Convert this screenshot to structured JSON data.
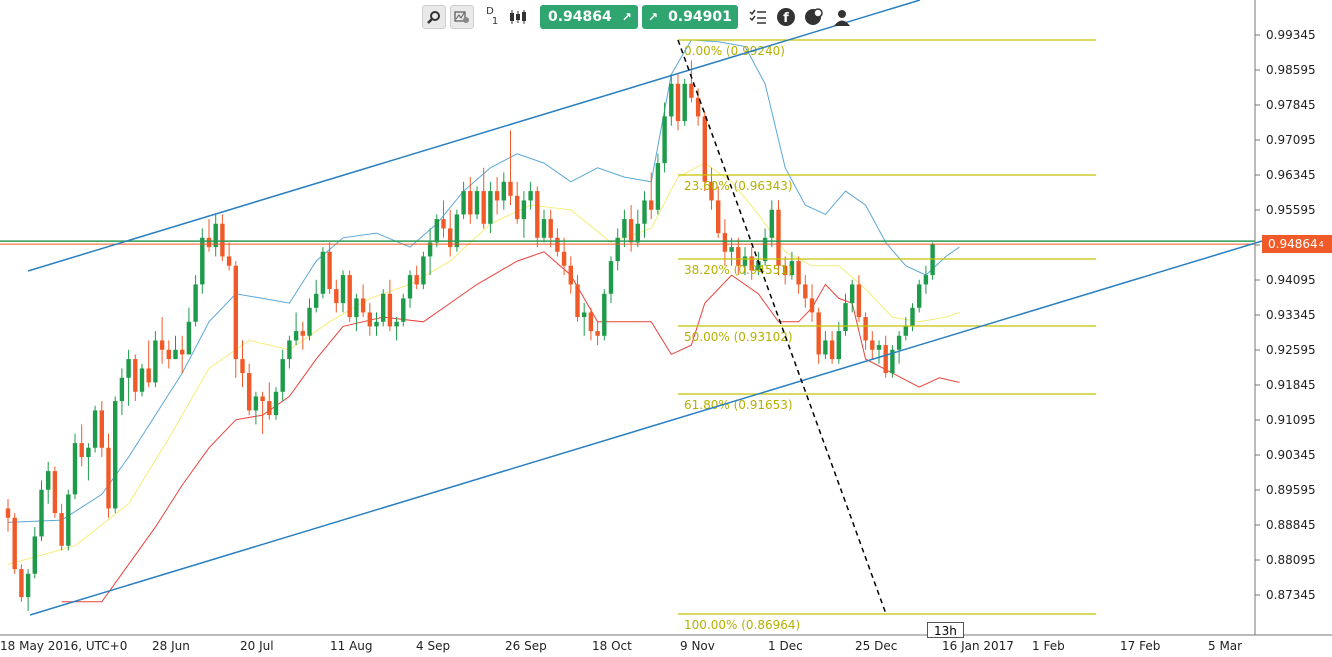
{
  "toolbar": {
    "zoom_icon": "magnifier-icon",
    "settings_icon": "chart-settings-icon",
    "timeframe_letter": "D",
    "timeframe_number": "1",
    "chart_type_icon": "candlestick-icon",
    "sell_price": "0.94864",
    "buy_price": "0.94901",
    "sell_arrow": "↗",
    "buy_arrow": "↗",
    "colors": {
      "price_button": "#2fa56f"
    }
  },
  "chart_data": {
    "type": "candlestick",
    "y_ticks": [
      "0.99345",
      "0.98595",
      "0.97845",
      "0.97095",
      "0.96345",
      "0.95595",
      "0.94845",
      "0.94095",
      "0.93345",
      "0.92595",
      "0.91845",
      "0.91095",
      "0.90345",
      "0.89595",
      "0.88845",
      "0.88095",
      "0.87345"
    ],
    "x_ticks": [
      "18 May 2016, UTC+0",
      "28 Jun",
      "20 Jul",
      "11 Aug",
      "4 Sep",
      "26 Sep",
      "18 Oct",
      "9 Nov",
      "1 Dec",
      "25 Dec",
      "16 Jan 2017",
      "1 Feb",
      "17 Feb",
      "5 Mar"
    ],
    "current_price": "0.94864",
    "fib_levels": [
      {
        "label": "0.00% (0.99240)",
        "value": 0.9924
      },
      {
        "label": "23.60% (0.96343)",
        "value": 0.96343
      },
      {
        "label": "38.20% (0.94551)",
        "value": 0.94551
      },
      {
        "label": "50.00% (0.93102)",
        "value": 0.93102
      },
      {
        "label": "61.80% (0.91653)",
        "value": 0.91653
      },
      {
        "label": "100.00% (0.86964)",
        "value": 0.86964
      }
    ],
    "time_marker": "13h",
    "colors": {
      "up": "#1e9b4a",
      "down": "#f05a28",
      "fib": "#c8c200",
      "channel": "#2a7fc0",
      "upper_band": "#5aa7d6",
      "middle_band": "#f5ec7a",
      "lower_band": "#e8423a",
      "current_line": "#2a9b55",
      "current_tag": "#f05a28"
    },
    "candles": [
      [
        0.892,
        0.894,
        0.887,
        0.89
      ],
      [
        0.89,
        0.891,
        0.878,
        0.879
      ],
      [
        0.879,
        0.88,
        0.872,
        0.873
      ],
      [
        0.873,
        0.879,
        0.87,
        0.878
      ],
      [
        0.878,
        0.888,
        0.877,
        0.886
      ],
      [
        0.886,
        0.898,
        0.885,
        0.896
      ],
      [
        0.896,
        0.902,
        0.893,
        0.9
      ],
      [
        0.9,
        0.901,
        0.89,
        0.891
      ],
      [
        0.891,
        0.893,
        0.883,
        0.884
      ],
      [
        0.884,
        0.896,
        0.883,
        0.895
      ],
      [
        0.895,
        0.908,
        0.894,
        0.906
      ],
      [
        0.906,
        0.91,
        0.901,
        0.903
      ],
      [
        0.903,
        0.906,
        0.898,
        0.905
      ],
      [
        0.905,
        0.914,
        0.904,
        0.913
      ],
      [
        0.913,
        0.915,
        0.903,
        0.905
      ],
      [
        0.905,
        0.908,
        0.89,
        0.892
      ],
      [
        0.892,
        0.916,
        0.891,
        0.915
      ],
      [
        0.915,
        0.922,
        0.912,
        0.92
      ],
      [
        0.92,
        0.926,
        0.914,
        0.924
      ],
      [
        0.924,
        0.925,
        0.915,
        0.917
      ],
      [
        0.917,
        0.923,
        0.916,
        0.922
      ],
      [
        0.922,
        0.928,
        0.918,
        0.919
      ],
      [
        0.919,
        0.93,
        0.918,
        0.928
      ],
      [
        0.928,
        0.933,
        0.923,
        0.926
      ],
      [
        0.926,
        0.928,
        0.922,
        0.924
      ],
      [
        0.924,
        0.929,
        0.924,
        0.926
      ],
      [
        0.926,
        0.929,
        0.921,
        0.925
      ],
      [
        0.925,
        0.935,
        0.925,
        0.932
      ],
      [
        0.932,
        0.942,
        0.931,
        0.94
      ],
      [
        0.94,
        0.952,
        0.938,
        0.95
      ],
      [
        0.95,
        0.954,
        0.947,
        0.948
      ],
      [
        0.948,
        0.955,
        0.946,
        0.953
      ],
      [
        0.953,
        0.955,
        0.945,
        0.946
      ],
      [
        0.946,
        0.949,
        0.943,
        0.944
      ],
      [
        0.944,
        0.945,
        0.92,
        0.924
      ],
      [
        0.924,
        0.928,
        0.918,
        0.921
      ],
      [
        0.921,
        0.923,
        0.912,
        0.913
      ],
      [
        0.913,
        0.917,
        0.91,
        0.916
      ],
      [
        0.916,
        0.917,
        0.908,
        0.915
      ],
      [
        0.915,
        0.919,
        0.911,
        0.912
      ],
      [
        0.912,
        0.918,
        0.911,
        0.917
      ],
      [
        0.917,
        0.926,
        0.915,
        0.924
      ],
      [
        0.924,
        0.929,
        0.922,
        0.928
      ],
      [
        0.928,
        0.934,
        0.927,
        0.93
      ],
      [
        0.93,
        0.932,
        0.926,
        0.929
      ],
      [
        0.929,
        0.937,
        0.928,
        0.935
      ],
      [
        0.935,
        0.941,
        0.934,
        0.938
      ],
      [
        0.938,
        0.948,
        0.937,
        0.947
      ],
      [
        0.947,
        0.949,
        0.938,
        0.939
      ],
      [
        0.939,
        0.941,
        0.934,
        0.936
      ],
      [
        0.936,
        0.943,
        0.934,
        0.942
      ],
      [
        0.942,
        0.943,
        0.932,
        0.933
      ],
      [
        0.933,
        0.938,
        0.93,
        0.937
      ],
      [
        0.937,
        0.94,
        0.933,
        0.934
      ],
      [
        0.934,
        0.936,
        0.929,
        0.931
      ],
      [
        0.931,
        0.934,
        0.929,
        0.932
      ],
      [
        0.932,
        0.939,
        0.931,
        0.938
      ],
      [
        0.938,
        0.941,
        0.93,
        0.931
      ],
      [
        0.931,
        0.933,
        0.928,
        0.932
      ],
      [
        0.932,
        0.938,
        0.931,
        0.937
      ],
      [
        0.937,
        0.943,
        0.935,
        0.942
      ],
      [
        0.942,
        0.944,
        0.939,
        0.94
      ],
      [
        0.94,
        0.947,
        0.939,
        0.946
      ],
      [
        0.946,
        0.952,
        0.942,
        0.949
      ],
      [
        0.949,
        0.955,
        0.948,
        0.954
      ],
      [
        0.954,
        0.958,
        0.95,
        0.952
      ],
      [
        0.952,
        0.956,
        0.946,
        0.948
      ],
      [
        0.948,
        0.956,
        0.947,
        0.955
      ],
      [
        0.955,
        0.962,
        0.954,
        0.96
      ],
      [
        0.96,
        0.963,
        0.953,
        0.955
      ],
      [
        0.955,
        0.961,
        0.954,
        0.96
      ],
      [
        0.96,
        0.965,
        0.952,
        0.953
      ],
      [
        0.953,
        0.962,
        0.951,
        0.96
      ],
      [
        0.96,
        0.963,
        0.955,
        0.958
      ],
      [
        0.958,
        0.964,
        0.956,
        0.962
      ],
      [
        0.962,
        0.973,
        0.957,
        0.959
      ],
      [
        0.959,
        0.962,
        0.953,
        0.954
      ],
      [
        0.954,
        0.96,
        0.95,
        0.958
      ],
      [
        0.958,
        0.962,
        0.956,
        0.96
      ],
      [
        0.96,
        0.961,
        0.948,
        0.95
      ],
      [
        0.95,
        0.956,
        0.949,
        0.954
      ],
      [
        0.954,
        0.956,
        0.948,
        0.95
      ],
      [
        0.95,
        0.952,
        0.946,
        0.947
      ],
      [
        0.947,
        0.95,
        0.942,
        0.944
      ],
      [
        0.944,
        0.946,
        0.938,
        0.94
      ],
      [
        0.94,
        0.942,
        0.932,
        0.933
      ],
      [
        0.933,
        0.936,
        0.929,
        0.934
      ],
      [
        0.934,
        0.935,
        0.928,
        0.93
      ],
      [
        0.93,
        0.932,
        0.927,
        0.929
      ],
      [
        0.929,
        0.939,
        0.928,
        0.938
      ],
      [
        0.938,
        0.946,
        0.936,
        0.945
      ],
      [
        0.945,
        0.952,
        0.943,
        0.95
      ],
      [
        0.95,
        0.956,
        0.948,
        0.954
      ],
      [
        0.954,
        0.957,
        0.947,
        0.949
      ],
      [
        0.949,
        0.956,
        0.948,
        0.953
      ],
      [
        0.953,
        0.96,
        0.95,
        0.958
      ],
      [
        0.958,
        0.964,
        0.954,
        0.956
      ],
      [
        0.956,
        0.968,
        0.955,
        0.966
      ],
      [
        0.966,
        0.979,
        0.964,
        0.976
      ],
      [
        0.976,
        0.985,
        0.974,
        0.983
      ],
      [
        0.983,
        0.985,
        0.973,
        0.975
      ],
      [
        0.975,
        0.984,
        0.974,
        0.983
      ],
      [
        0.983,
        0.988,
        0.979,
        0.98
      ],
      [
        0.98,
        0.982,
        0.974,
        0.976
      ],
      [
        0.976,
        0.977,
        0.96,
        0.962
      ],
      [
        0.962,
        0.965,
        0.956,
        0.958
      ],
      [
        0.958,
        0.961,
        0.95,
        0.951
      ],
      [
        0.951,
        0.954,
        0.944,
        0.947
      ],
      [
        0.947,
        0.95,
        0.944,
        0.948
      ],
      [
        0.948,
        0.95,
        0.942,
        0.944
      ],
      [
        0.944,
        0.948,
        0.942,
        0.946
      ],
      [
        0.946,
        0.948,
        0.941,
        0.943
      ],
      [
        0.943,
        0.947,
        0.942,
        0.945
      ],
      [
        0.945,
        0.952,
        0.944,
        0.95
      ],
      [
        0.95,
        0.958,
        0.948,
        0.956
      ],
      [
        0.956,
        0.958,
        0.942,
        0.944
      ],
      [
        0.944,
        0.946,
        0.94,
        0.942
      ],
      [
        0.942,
        0.947,
        0.941,
        0.945
      ],
      [
        0.945,
        0.946,
        0.938,
        0.94
      ],
      [
        0.94,
        0.942,
        0.935,
        0.937
      ],
      [
        0.937,
        0.94,
        0.932,
        0.934
      ],
      [
        0.934,
        0.935,
        0.923,
        0.925
      ],
      [
        0.925,
        0.93,
        0.924,
        0.928
      ],
      [
        0.928,
        0.93,
        0.923,
        0.924
      ],
      [
        0.924,
        0.932,
        0.923,
        0.93
      ],
      [
        0.93,
        0.938,
        0.929,
        0.936
      ],
      [
        0.936,
        0.941,
        0.934,
        0.94
      ],
      [
        0.94,
        0.942,
        0.932,
        0.933
      ],
      [
        0.933,
        0.934,
        0.926,
        0.928
      ],
      [
        0.928,
        0.93,
        0.924,
        0.926
      ],
      [
        0.926,
        0.928,
        0.923,
        0.927
      ],
      [
        0.927,
        0.929,
        0.92,
        0.921
      ],
      [
        0.921,
        0.927,
        0.92,
        0.926
      ],
      [
        0.926,
        0.93,
        0.923,
        0.929
      ],
      [
        0.929,
        0.933,
        0.928,
        0.931
      ],
      [
        0.931,
        0.936,
        0.93,
        0.935
      ],
      [
        0.935,
        0.941,
        0.934,
        0.94
      ],
      [
        0.94,
        0.944,
        0.938,
        0.942
      ],
      [
        0.942,
        0.949,
        0.941,
        0.9486
      ]
    ],
    "upper_band": [
      [
        0,
        0.889
      ],
      [
        8,
        0.8895
      ],
      [
        14,
        0.895
      ],
      [
        18,
        0.903
      ],
      [
        22,
        0.912
      ],
      [
        26,
        0.921
      ],
      [
        30,
        0.932
      ],
      [
        34,
        0.938
      ],
      [
        38,
        0.937
      ],
      [
        42,
        0.936
      ],
      [
        46,
        0.945
      ],
      [
        50,
        0.95
      ],
      [
        55,
        0.951
      ],
      [
        60,
        0.948
      ],
      [
        64,
        0.953
      ],
      [
        68,
        0.96
      ],
      [
        72,
        0.965
      ],
      [
        76,
        0.968
      ],
      [
        80,
        0.966
      ],
      [
        84,
        0.962
      ],
      [
        88,
        0.965
      ],
      [
        92,
        0.963
      ],
      [
        96,
        0.962
      ],
      [
        99,
        0.985
      ],
      [
        102,
        0.9924
      ],
      [
        106,
        0.992
      ],
      [
        110,
        0.991
      ],
      [
        113,
        0.983
      ],
      [
        116,
        0.965
      ],
      [
        119,
        0.957
      ],
      [
        122,
        0.955
      ],
      [
        125,
        0.96
      ],
      [
        128,
        0.957
      ],
      [
        131,
        0.949
      ],
      [
        134,
        0.944
      ],
      [
        137,
        0.942
      ],
      [
        140,
        0.946
      ],
      [
        142,
        0.948
      ]
    ],
    "middle_band": [
      [
        0,
        0.88
      ],
      [
        10,
        0.884
      ],
      [
        18,
        0.893
      ],
      [
        24,
        0.907
      ],
      [
        30,
        0.922
      ],
      [
        36,
        0.928
      ],
      [
        42,
        0.926
      ],
      [
        48,
        0.932
      ],
      [
        54,
        0.937
      ],
      [
        60,
        0.94
      ],
      [
        66,
        0.945
      ],
      [
        72,
        0.953
      ],
      [
        78,
        0.957
      ],
      [
        84,
        0.956
      ],
      [
        90,
        0.949
      ],
      [
        96,
        0.952
      ],
      [
        100,
        0.963
      ],
      [
        104,
        0.966
      ],
      [
        108,
        0.962
      ],
      [
        112,
        0.955
      ],
      [
        116,
        0.947
      ],
      [
        120,
        0.944
      ],
      [
        124,
        0.944
      ],
      [
        128,
        0.939
      ],
      [
        132,
        0.933
      ],
      [
        136,
        0.932
      ],
      [
        140,
        0.933
      ],
      [
        142,
        0.934
      ]
    ],
    "lower_band": [
      [
        8,
        0.872
      ],
      [
        14,
        0.872
      ],
      [
        18,
        0.88
      ],
      [
        22,
        0.888
      ],
      [
        26,
        0.897
      ],
      [
        30,
        0.905
      ],
      [
        34,
        0.911
      ],
      [
        38,
        0.912
      ],
      [
        42,
        0.916
      ],
      [
        46,
        0.924
      ],
      [
        50,
        0.931
      ],
      [
        56,
        0.933
      ],
      [
        62,
        0.932
      ],
      [
        66,
        0.936
      ],
      [
        70,
        0.94
      ],
      [
        76,
        0.945
      ],
      [
        80,
        0.947
      ],
      [
        84,
        0.942
      ],
      [
        88,
        0.932
      ],
      [
        92,
        0.932
      ],
      [
        96,
        0.932
      ],
      [
        99,
        0.925
      ],
      [
        102,
        0.927
      ],
      [
        104,
        0.936
      ],
      [
        108,
        0.942
      ],
      [
        112,
        0.938
      ],
      [
        115,
        0.932
      ],
      [
        118,
        0.932
      ],
      [
        120,
        0.935
      ],
      [
        122,
        0.94
      ],
      [
        124,
        0.937
      ],
      [
        126,
        0.936
      ],
      [
        128,
        0.924
      ],
      [
        132,
        0.921
      ],
      [
        136,
        0.918
      ],
      [
        139,
        0.92
      ],
      [
        142,
        0.919
      ]
    ]
  }
}
